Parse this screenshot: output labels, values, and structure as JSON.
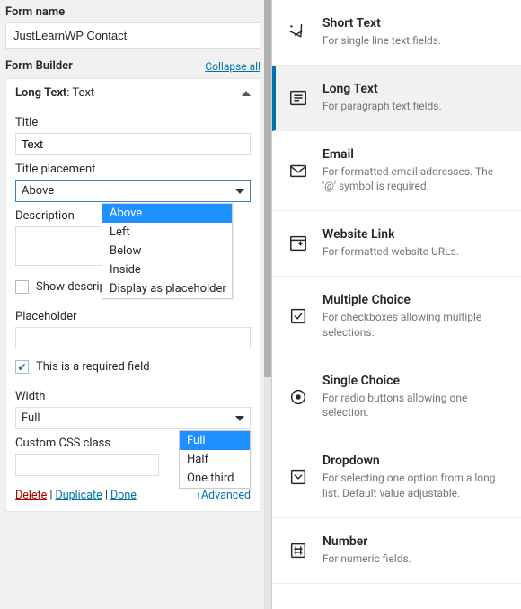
{
  "form_name_label": "Form name",
  "form_name_value": "JustLearnWP Contact",
  "builder_title": "Form Builder",
  "collapse_all": "Collapse all",
  "card": {
    "type": "Long Text",
    "sep": ": ",
    "suffix": "Text",
    "title_label": "Title",
    "title_value": "Text",
    "placement_label": "Title placement",
    "placement_value": "Above",
    "placement_options": [
      "Above",
      "Left",
      "Below",
      "Inside",
      "Display as placeholder"
    ],
    "description_label": "Description",
    "show_tooltip": "Show description in a tooltip",
    "placeholder_label": "Placeholder",
    "required_label": "This is a required field",
    "width_label": "Width",
    "width_value": "Full",
    "width_options": [
      "Full",
      "Half",
      "One third"
    ],
    "css_label": "Custom CSS class",
    "delete": "Delete",
    "duplicate": "Duplicate",
    "done": "Done",
    "advanced": "Advanced"
  },
  "field_types": [
    {
      "id": "short-text",
      "title": "Short Text",
      "desc": "For single line text fields."
    },
    {
      "id": "long-text",
      "title": "Long Text",
      "desc": "For paragraph text fields.",
      "selected": true
    },
    {
      "id": "email",
      "title": "Email",
      "desc": "For formatted email addresses. The '@' symbol is required."
    },
    {
      "id": "website",
      "title": "Website Link",
      "desc": "For formatted website URLs."
    },
    {
      "id": "multiple-choice",
      "title": "Multiple Choice",
      "desc": "For checkboxes allowing multiple selections."
    },
    {
      "id": "single-choice",
      "title": "Single Choice",
      "desc": "For radio buttons allowing one selection."
    },
    {
      "id": "dropdown",
      "title": "Dropdown",
      "desc": "For selecting one option from a long list. Default value adjustable."
    },
    {
      "id": "number",
      "title": "Number",
      "desc": "For numeric fields."
    }
  ]
}
